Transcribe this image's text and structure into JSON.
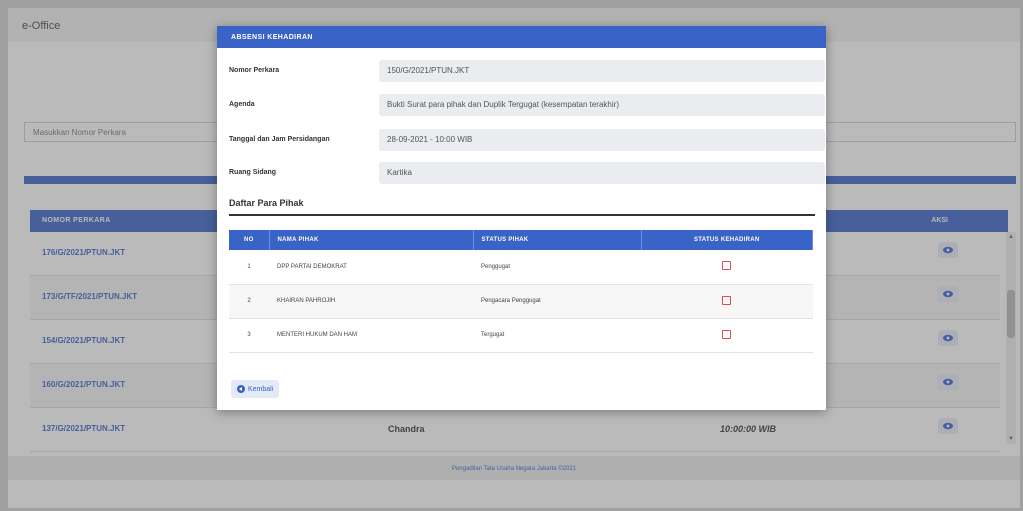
{
  "app": {
    "title": "e-Office"
  },
  "search": {
    "placeholder": "Masukkan Nomor Perkara"
  },
  "background_table": {
    "header_left": "NOMOR PERKARA",
    "header_right": "AKSI",
    "rows": [
      {
        "case_no": "176/G/2021/PTUN.JKT",
        "middle": "",
        "time": ""
      },
      {
        "case_no": "173/G/TF/2021/PTUN.JKT",
        "middle": "",
        "time": ""
      },
      {
        "case_no": "154/G/2021/PTUN.JKT",
        "middle": "",
        "time": ""
      },
      {
        "case_no": "160/G/2021/PTUN.JKT",
        "middle": "",
        "time": ""
      },
      {
        "case_no": "137/G/2021/PTUN.JKT",
        "middle": "Chandra",
        "time": "10:00:00 WIB"
      }
    ]
  },
  "footer": {
    "text": "Pengadilan Tata Usaha Negara Jakarta ©2021"
  },
  "modal": {
    "title": "ABSENSI KEHADIRAN",
    "fields": [
      {
        "label": "Nomor Perkara",
        "value": "150/G/2021/PTUN.JKT"
      },
      {
        "label": "Agenda",
        "value": "Bukti Surat para pihak dan Duplik Tergugat (kesempatan terakhir)"
      },
      {
        "label": "Tanggal dan Jam Persidangan",
        "value": "28-09-2021 - 10:00 WIB"
      },
      {
        "label": "Ruang Sidang",
        "value": "Kartika"
      }
    ],
    "section_title": "Daftar Para Pihak",
    "table_headers": {
      "no": "NO",
      "name": "NAMA PIHAK",
      "status": "STATUS PIHAK",
      "attendance": "STATUS KEHADIRAN"
    },
    "parties": [
      {
        "no": "1",
        "name": "DPP PARTAI DEMOKRAT",
        "status": "Penggugat"
      },
      {
        "no": "2",
        "name": "KHAIRAN PAHROJIH",
        "status": "Pengacara Penggugat"
      },
      {
        "no": "3",
        "name": "MENTERI HUKUM DAN HAM",
        "status": "Tergugat"
      }
    ],
    "back_label": "Kembali"
  },
  "colors": {
    "primary": "#3a63c8",
    "danger": "#e0484a"
  }
}
